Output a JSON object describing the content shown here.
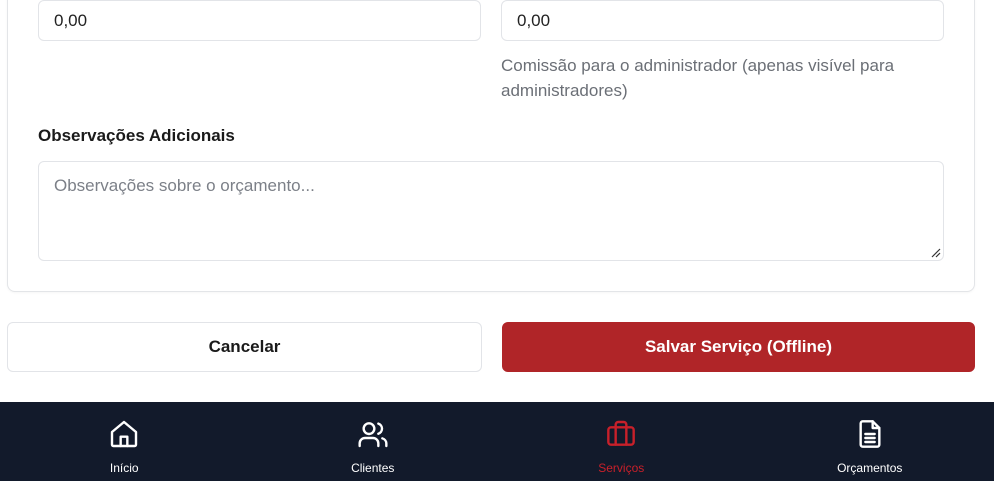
{
  "form": {
    "field_left_value": "0,00",
    "field_right_value": "0,00",
    "commission_help": "Comissão para o administrador (apenas visível para administradores)",
    "notes_label": "Observações Adicionais",
    "notes_placeholder": "Observações sobre o orçamento..."
  },
  "actions": {
    "cancel_label": "Cancelar",
    "save_label": "Salvar Serviço (Offline)"
  },
  "bottom_nav": {
    "items": [
      {
        "label": "Início",
        "icon": "home-icon",
        "active": false
      },
      {
        "label": "Clientes",
        "icon": "users-icon",
        "active": false
      },
      {
        "label": "Serviços",
        "icon": "briefcase-icon",
        "active": true
      },
      {
        "label": "Orçamentos",
        "icon": "file-text-icon",
        "active": false
      }
    ]
  },
  "colors": {
    "primary": "#b02528",
    "nav_background": "#121a2b",
    "nav_active": "#c8202a",
    "help_text": "#6b6f76"
  }
}
